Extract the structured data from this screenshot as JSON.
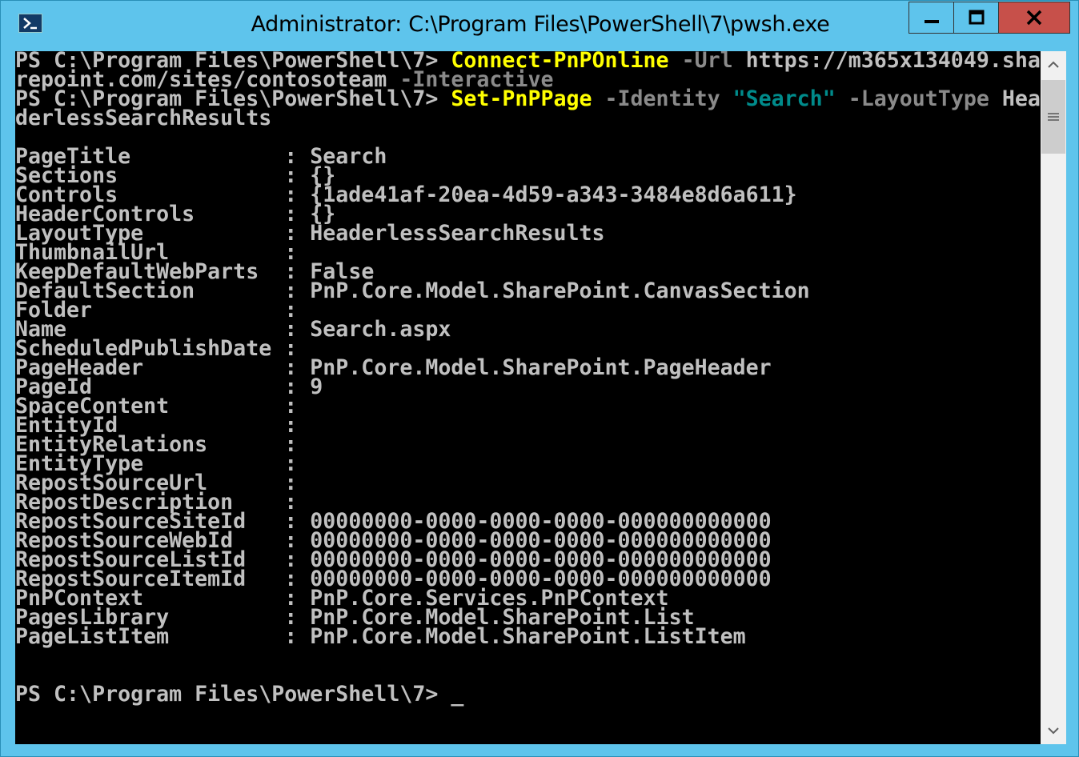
{
  "window": {
    "title": "Administrator: C:\\Program Files\\PowerShell\\7\\pwsh.exe",
    "icon": "powershell-icon",
    "controls": [
      "minimize-icon",
      "maximize-icon",
      "close-icon"
    ]
  },
  "colors": {
    "frame": "#5ec4ec",
    "console_bg": "#000000",
    "text": "#c0c0c0",
    "command": "#ffff00",
    "parameter": "#8a8a8a",
    "string": "#008b8b",
    "close_button": "#c7504a"
  },
  "console": {
    "line1": {
      "prompt": "PS C:\\Program Files\\PowerShell\\7> ",
      "cmd": "Connect-PnPOnline",
      "param": " -Url",
      "arg": " https://m365x134049.sha"
    },
    "line2": {
      "arg": "repoint.com/sites/contosoteam",
      "param": " -Interactive"
    },
    "line3": {
      "prompt": "PS C:\\Program Files\\PowerShell\\7> ",
      "cmd": "Set-PnPPage",
      "param1": " -Identity",
      "str": " \"Search\"",
      "param2": " -LayoutType",
      "arg": " Hea"
    },
    "line4": {
      "arg": "derlessSearchResults"
    },
    "properties": [
      {
        "name": "PageTitle",
        "value": "Search"
      },
      {
        "name": "Sections",
        "value": "{}"
      },
      {
        "name": "Controls",
        "value": "{1ade41af-20ea-4d59-a343-3484e8d6a611}"
      },
      {
        "name": "HeaderControls",
        "value": "{}"
      },
      {
        "name": "LayoutType",
        "value": "HeaderlessSearchResults"
      },
      {
        "name": "ThumbnailUrl",
        "value": ""
      },
      {
        "name": "KeepDefaultWebParts",
        "value": "False"
      },
      {
        "name": "DefaultSection",
        "value": "PnP.Core.Model.SharePoint.CanvasSection"
      },
      {
        "name": "Folder",
        "value": ""
      },
      {
        "name": "Name",
        "value": "Search.aspx"
      },
      {
        "name": "ScheduledPublishDate",
        "value": ""
      },
      {
        "name": "PageHeader",
        "value": "PnP.Core.Model.SharePoint.PageHeader"
      },
      {
        "name": "PageId",
        "value": "9"
      },
      {
        "name": "SpaceContent",
        "value": ""
      },
      {
        "name": "EntityId",
        "value": ""
      },
      {
        "name": "EntityRelations",
        "value": ""
      },
      {
        "name": "EntityType",
        "value": ""
      },
      {
        "name": "RepostSourceUrl",
        "value": ""
      },
      {
        "name": "RepostDescription",
        "value": ""
      },
      {
        "name": "RepostSourceSiteId",
        "value": "00000000-0000-0000-0000-000000000000"
      },
      {
        "name": "RepostSourceWebId",
        "value": "00000000-0000-0000-0000-000000000000"
      },
      {
        "name": "RepostSourceListId",
        "value": "00000000-0000-0000-0000-000000000000"
      },
      {
        "name": "RepostSourceItemId",
        "value": "00000000-0000-0000-0000-000000000000"
      },
      {
        "name": "PnPContext",
        "value": "PnP.Core.Services.PnPContext"
      },
      {
        "name": "PagesLibrary",
        "value": "PnP.Core.Model.SharePoint.List"
      },
      {
        "name": "PageListItem",
        "value": "PnP.Core.Model.SharePoint.ListItem"
      }
    ],
    "separator": ":",
    "final_prompt": "PS C:\\Program Files\\PowerShell\\7> ",
    "cursor": "_"
  },
  "scrollbar": {
    "up": "chevron-up-icon",
    "thumb": "grip-icon",
    "down": "chevron-down-icon"
  }
}
